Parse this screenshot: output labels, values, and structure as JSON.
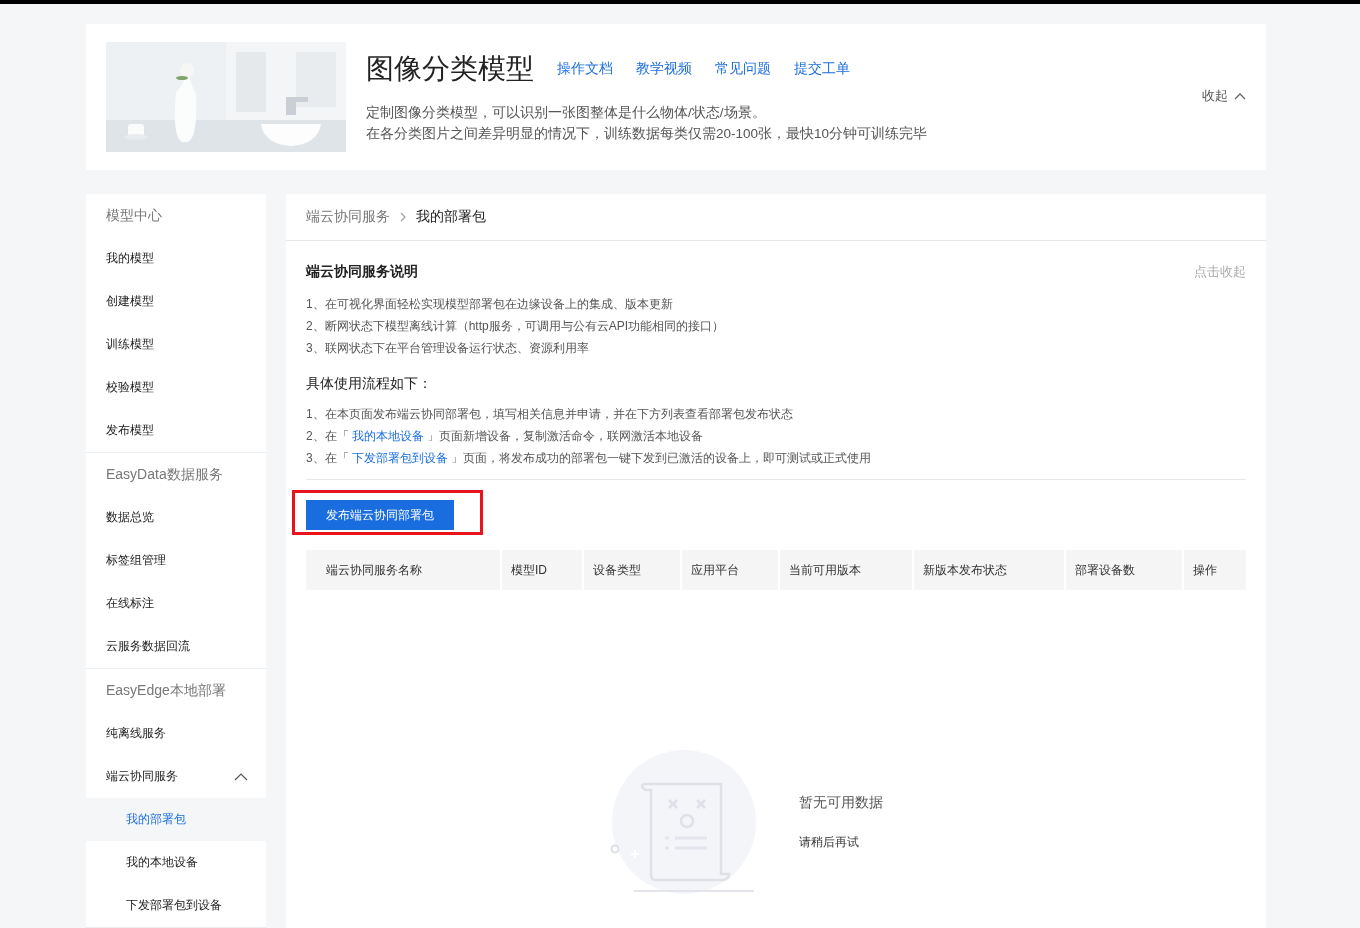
{
  "header": {
    "title": "图像分类模型",
    "links": [
      "操作文档",
      "教学视频",
      "常见问题",
      "提交工单"
    ],
    "description": [
      "定制图像分类模型，可以识别一张图整体是什么物体/状态/场景。",
      "在各分类图片之间差异明显的情况下，训练数据每类仅需20-100张，最快10分钟可训练完毕"
    ],
    "collapse": "收起"
  },
  "sidebar": {
    "groups": [
      {
        "title": "模型中心",
        "items": [
          {
            "label": "我的模型",
            "selected": false
          },
          {
            "label": "创建模型",
            "selected": false
          },
          {
            "label": "训练模型",
            "selected": false
          },
          {
            "label": "校验模型",
            "selected": false
          },
          {
            "label": "发布模型",
            "selected": false
          }
        ]
      },
      {
        "title": "EasyData数据服务",
        "items": [
          {
            "label": "数据总览",
            "selected": false
          },
          {
            "label": "标签组管理",
            "selected": false
          },
          {
            "label": "在线标注",
            "selected": false
          },
          {
            "label": "云服务数据回流",
            "selected": false
          }
        ]
      },
      {
        "title": "EasyEdge本地部署",
        "items": [
          {
            "label": "纯离线服务",
            "selected": false
          },
          {
            "label": "端云协同服务",
            "selected": false,
            "expanded": true,
            "children": [
              {
                "label": "我的部署包",
                "selected": true
              },
              {
                "label": "我的本地设备",
                "selected": false
              },
              {
                "label": "下发部署包到设备",
                "selected": false
              }
            ]
          }
        ]
      }
    ]
  },
  "breadcrumb": [
    "端云协同服务",
    "我的部署包"
  ],
  "intro": {
    "title": "端云协同服务说明",
    "collapse": "点击收起",
    "points": [
      "1、在可视化界面轻松实现模型部署包在边缘设备上的集成、版本更新",
      "2、断网状态下模型离线计算（http服务，可调用与公有云API功能相同的接口）",
      "3、联网状态下在平台管理设备运行状态、资源利用率"
    ],
    "steps_title": "具体使用流程如下：",
    "steps": [
      {
        "before": "1、在本页面发布端云协同部署包，填写相关信息并申请，并在下方列表查看部署包发布状态"
      },
      {
        "before": "2、在「 ",
        "link": "我的本地设备",
        "after": " 」页面新增设备，复制激活命令，联网激活本地设备"
      },
      {
        "before": "3、在「 ",
        "link": "下发部署包到设备",
        "after": " 」页面，将发布成功的部署包一键下发到已激活的设备上，即可测试或正式使用"
      }
    ]
  },
  "publish_button": "发布端云协同部署包",
  "table": {
    "columns": [
      "端云协同服务名称",
      "模型ID",
      "设备类型",
      "应用平台",
      "当前可用版本",
      "新版本发布状态",
      "部署设备数",
      "操作"
    ]
  },
  "empty": {
    "title": "暂无可用数据",
    "hint": "请稍后再试"
  }
}
